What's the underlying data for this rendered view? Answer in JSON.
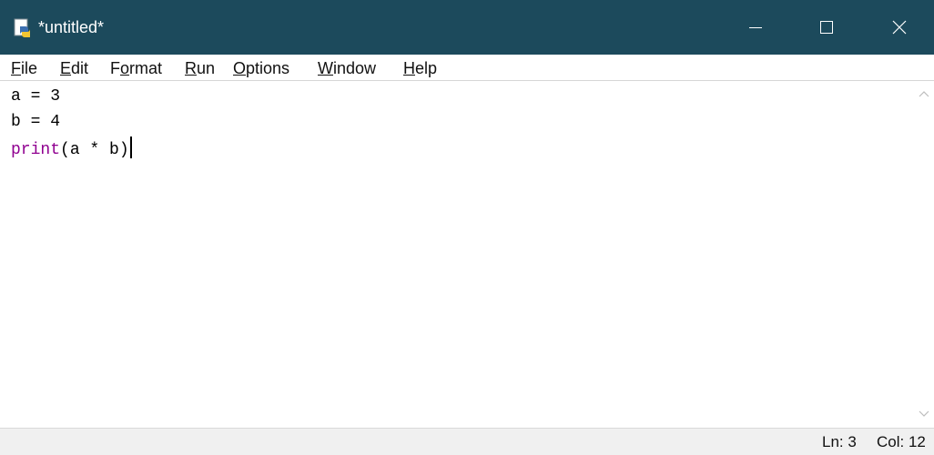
{
  "window": {
    "title": "*untitled*"
  },
  "menu": {
    "file": {
      "mnemonic": "F",
      "rest": "ile"
    },
    "edit": {
      "mnemonic": "E",
      "rest": "dit"
    },
    "format": {
      "pre": "F",
      "mnemonic": "o",
      "rest": "rmat"
    },
    "run": {
      "mnemonic": "R",
      "rest": "un"
    },
    "options": {
      "mnemonic": "O",
      "rest": "ptions"
    },
    "window": {
      "mnemonic": "W",
      "rest": "indow"
    },
    "help": {
      "mnemonic": "H",
      "rest": "elp"
    }
  },
  "editor": {
    "line1": "a = 3",
    "line2": "b = 4",
    "line3_builtin": "print",
    "line3_rest": "(a * b)"
  },
  "status": {
    "ln": "Ln: 3",
    "col": "Col: 12"
  },
  "colors": {
    "titlebar": "#1c4a5c",
    "builtin": "#900090"
  }
}
